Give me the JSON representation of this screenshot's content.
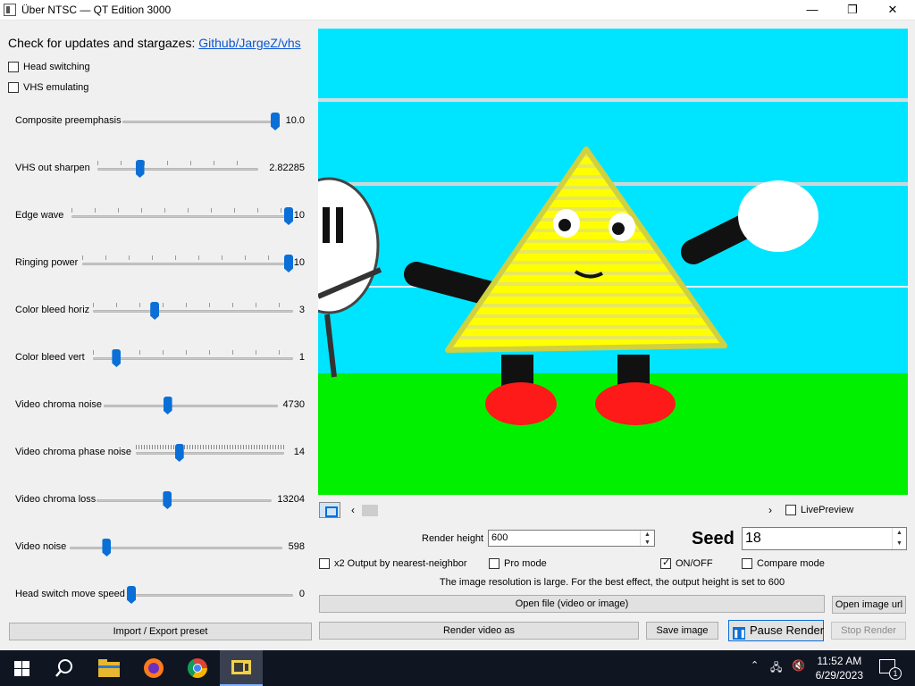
{
  "window": {
    "title": "Über NTSC — QT Edition 3000",
    "minimize": "—",
    "maximize": "❐",
    "close": "✕"
  },
  "updates": {
    "text": "Check for updates and stargazes:",
    "link": "Github/JargeZ/vhs"
  },
  "checkboxes": {
    "head_switching": "Head switching",
    "vhs_emulating": "VHS emulating"
  },
  "sliders": [
    {
      "label": "Composite preemphasis",
      "value": "10.0",
      "fraction": 1.0
    },
    {
      "label": "VHS out sharpen",
      "value": "2.82285",
      "fraction": 0.25
    },
    {
      "label": "Edge wave",
      "value": "10",
      "fraction": 1.0
    },
    {
      "label": "Ringing power",
      "value": "10",
      "fraction": 1.0
    },
    {
      "label": "Color bleed horiz",
      "value": "3",
      "fraction": 0.3
    },
    {
      "label": "Color bleed vert",
      "value": "1",
      "fraction": 0.1
    },
    {
      "label": "Video chroma noise",
      "value": "4730",
      "fraction": 0.36
    },
    {
      "label": "Video chroma phase noise",
      "value": "14",
      "fraction": 0.28
    },
    {
      "label": "Video chroma loss",
      "value": "13204",
      "fraction": 0.4
    },
    {
      "label": "Video noise",
      "value": "598",
      "fraction": 0.16
    },
    {
      "label": "Head switch move speed",
      "value": "0",
      "fraction": 0.0
    }
  ],
  "buttons": {
    "import_export": "Import / Export preset",
    "open_file": "Open file (video or image)",
    "open_image_url": "Open image url",
    "render_video_as": "Render video as",
    "save_image": "Save image",
    "pause_render": "Pause Render",
    "stop_render": "Stop Render"
  },
  "preview": {
    "live_preview": "LivePreview",
    "prev_arrow": "‹",
    "next_arrow": "›"
  },
  "render": {
    "height_label": "Render height",
    "height_value": "600",
    "seed_label": "Seed",
    "seed_value": "18",
    "x2_output": "x2 Output by nearest-neighbor",
    "pro_mode": "Pro mode",
    "on_off": "ON/OFF",
    "compare_mode": "Compare mode",
    "notice": "The image resolution is large. For the best effect, the output height is set to 600"
  },
  "taskbar": {
    "time": "11:52 AM",
    "date": "6/29/2023",
    "notifications": "1",
    "colors": {
      "bar": "#101522",
      "active": "#3b4050"
    }
  },
  "colors": {
    "accent": "#0a6fd6",
    "sky": "#00e5ff",
    "grass": "#00f000",
    "character": "#ffff00",
    "shoes": "#ff1a1a"
  }
}
